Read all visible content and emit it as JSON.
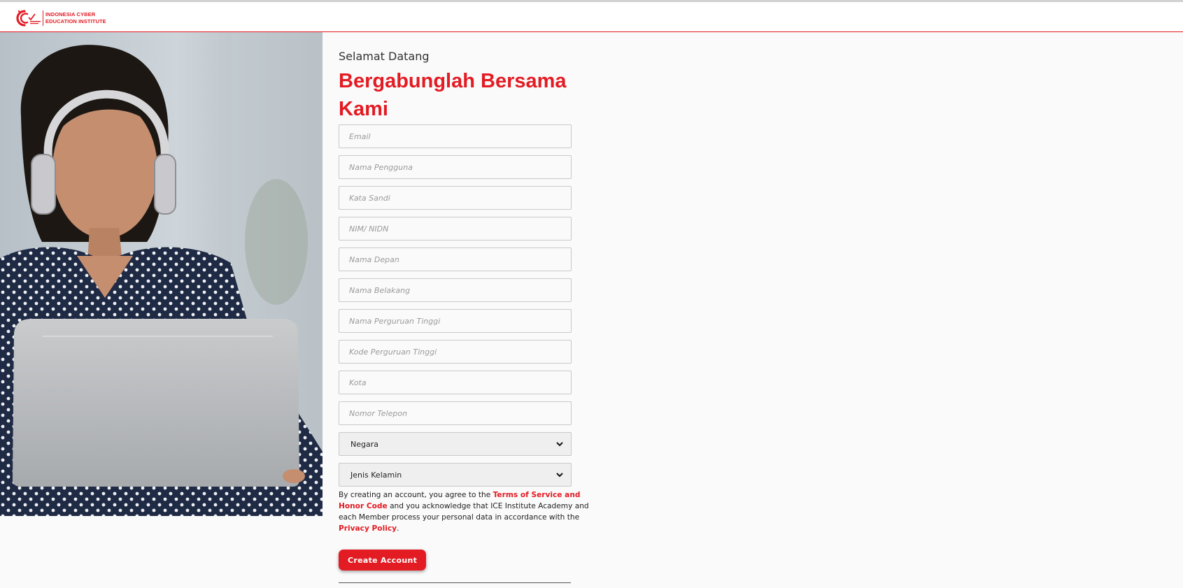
{
  "brand": {
    "line1": "INDONESIA CYBER",
    "line2": "EDUCATION INSTITUTE",
    "accent_color": "#e31b23"
  },
  "hero": {
    "image": "woman-with-headphones-using-laptop"
  },
  "form": {
    "welcome": "Selamat Datang",
    "headline": "Bergabunglah Bersama Kami",
    "fields": {
      "email": {
        "placeholder": "Email",
        "value": ""
      },
      "username": {
        "placeholder": "Nama Pengguna",
        "value": ""
      },
      "password": {
        "placeholder": "Kata Sandi",
        "value": ""
      },
      "nim": {
        "placeholder": "NIM/ NIDN",
        "value": ""
      },
      "first_name": {
        "placeholder": "Nama Depan",
        "value": ""
      },
      "last_name": {
        "placeholder": "Nama Belakang",
        "value": ""
      },
      "university": {
        "placeholder": "Nama Perguruan Tinggi",
        "value": ""
      },
      "university_code": {
        "placeholder": "Kode Perguruan Tinggi",
        "value": ""
      },
      "city": {
        "placeholder": "Kota",
        "value": ""
      },
      "phone": {
        "placeholder": "Nomor Telepon",
        "value": ""
      }
    },
    "country_select": {
      "value": "Negara"
    },
    "gender_select": {
      "value": "Jenis Kelamin"
    },
    "terms": {
      "text1": "By creating an account, you agree to the ",
      "tos_link": "Terms of Service and Honor Code",
      "text2": " and you acknowledge that ICE Institute Academy and each Member process your personal data in accordance with the ",
      "privacy_link": "Privacy Policy",
      "text3": "."
    },
    "submit_label": "Create Account"
  }
}
